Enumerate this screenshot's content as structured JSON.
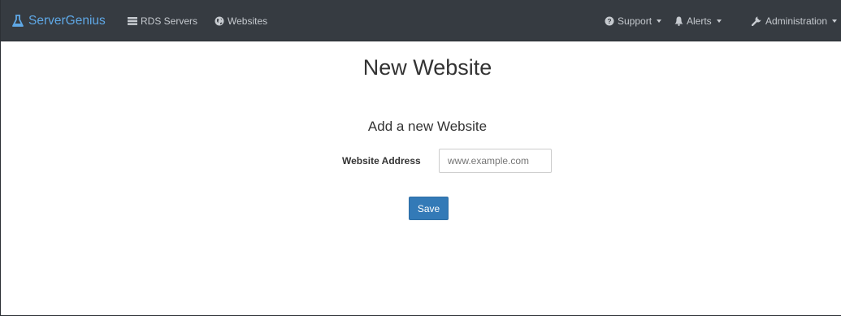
{
  "navbar": {
    "brand": "ServerGenius",
    "brand_icon": "flask-icon",
    "items": [
      {
        "label": "RDS Servers",
        "icon": "server-icon"
      },
      {
        "label": "Websites",
        "icon": "globe-icon"
      }
    ],
    "right_items": [
      {
        "label": "Support",
        "icon": "question-circle-icon"
      },
      {
        "label": "Alerts",
        "icon": "bell-icon"
      },
      {
        "label": "Administration",
        "icon": "wrench-icon"
      }
    ],
    "background_color": "#363b41",
    "brand_color": "#5fa8e6"
  },
  "main": {
    "title": "New Website",
    "form": {
      "heading": "Add a new Website",
      "field_label": "Website Address",
      "field_placeholder": "www.example.com",
      "field_value": "",
      "save_label": "Save",
      "save_color": "#337ab7"
    }
  }
}
